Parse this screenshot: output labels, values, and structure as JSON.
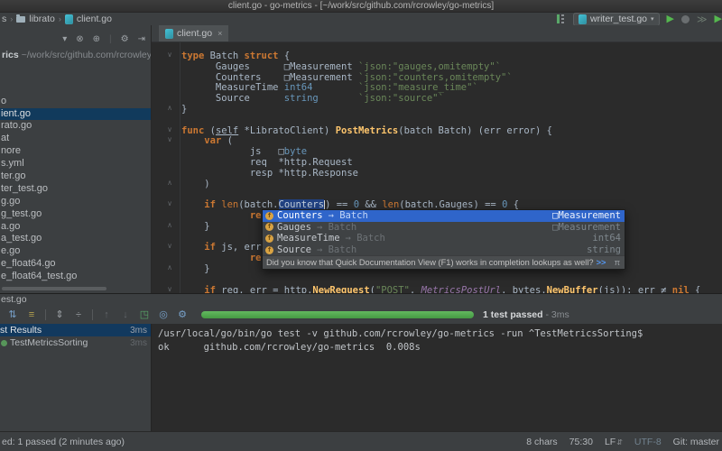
{
  "icons": {
    "chevron": "›",
    "dropdown": "▾",
    "gear": "⚙",
    "close": "×",
    "run": "▶",
    "coverage": "≫",
    "locate": "⊗",
    "target": "⊕",
    "hide_panel": "⇥",
    "lf_arrows": "⇵",
    "fold_open": "∨",
    "fold_close": "∧",
    "pi": "π",
    "link_arrows": ">>",
    "field": "f"
  },
  "titlebar": {
    "title": "client.go - go-metrics - [~/work/src/github.com/rcrowley/go-metrics]"
  },
  "navbar": {
    "crumbs": [
      {
        "label": "s"
      },
      {
        "label": "librato"
      },
      {
        "label": "client.go"
      }
    ],
    "run_config": "writer_test.go"
  },
  "project_panel": {
    "root_name": "rics",
    "root_path": " ~/work/src/github.com/rcrowley",
    "items": [
      {
        "label": ""
      },
      {
        "label": ""
      },
      {
        "label": ""
      },
      {
        "label": "o"
      },
      {
        "label": "ient.go",
        "selected": true
      },
      {
        "label": "rato.go"
      },
      {
        "label": "at"
      },
      {
        "label": "nore"
      },
      {
        "label": "s.yml"
      },
      {
        "label": "ter.go"
      },
      {
        "label": "ter_test.go"
      },
      {
        "label": "g.go"
      },
      {
        "label": "g_test.go"
      },
      {
        "label": "a.go"
      },
      {
        "label": "a_test.go"
      },
      {
        "label": "e.go"
      },
      {
        "label": "e_float64.go"
      },
      {
        "label": "e_float64_test.go"
      }
    ]
  },
  "editor": {
    "tab": "client.go",
    "lines": [
      [
        {
          "t": "type ",
          "c": "k"
        },
        {
          "t": "Batch ",
          "c": "p"
        },
        {
          "t": "struct ",
          "c": "k"
        },
        {
          "t": "{",
          "c": "p"
        }
      ],
      [
        {
          "t": "      Gauges      ",
          "c": "p"
        },
        {
          "t": "□Measurement ",
          "c": "p"
        },
        {
          "t": "`json:\"gauges,omitempty\"`",
          "c": "s"
        }
      ],
      [
        {
          "t": "      Counters    ",
          "c": "p"
        },
        {
          "t": "□Measurement ",
          "c": "p"
        },
        {
          "t": "`json:\"counters,omitempty\"`",
          "c": "s"
        }
      ],
      [
        {
          "t": "      MeasureTime ",
          "c": "p"
        },
        {
          "t": "int64",
          "c": "t"
        },
        {
          "t": "        ",
          "c": "p"
        },
        {
          "t": "`json:\"measure_time\"`",
          "c": "s"
        }
      ],
      [
        {
          "t": "      Source      ",
          "c": "p"
        },
        {
          "t": "string",
          "c": "t"
        },
        {
          "t": "       ",
          "c": "p"
        },
        {
          "t": "`json:\"source\"`",
          "c": "s"
        }
      ],
      [
        {
          "t": "}",
          "c": "p"
        }
      ],
      [],
      [
        {
          "t": "func ",
          "c": "k"
        },
        {
          "t": "(",
          "c": "p"
        },
        {
          "t": "self",
          "c": "u"
        },
        {
          "t": " *LibratoClient) ",
          "c": "p"
        },
        {
          "t": "PostMetrics",
          "c": "f"
        },
        {
          "t": "(batch Batch) (err error) {",
          "c": "p"
        }
      ],
      [
        {
          "t": "    ",
          "c": "p"
        },
        {
          "t": "var",
          "c": "k"
        },
        {
          "t": " (",
          "c": "p"
        }
      ],
      [
        {
          "t": "            js   ",
          "c": "p"
        },
        {
          "t": "□",
          "c": "p"
        },
        {
          "t": "byte",
          "c": "t"
        }
      ],
      [
        {
          "t": "            req  *http.Request",
          "c": "p"
        }
      ],
      [
        {
          "t": "            resp *http.Response",
          "c": "p"
        }
      ],
      [
        {
          "t": "    )",
          "c": "p"
        }
      ],
      [],
      [
        {
          "t": "    ",
          "c": "p"
        },
        {
          "t": "if ",
          "c": "k"
        },
        {
          "t": "len",
          "c": "b"
        },
        {
          "t": "(batch.",
          "c": "p"
        },
        {
          "t": "Counters",
          "c": "sel"
        },
        {
          "t": "",
          "c": "caret"
        },
        {
          "t": ") == ",
          "c": "p"
        },
        {
          "t": "0",
          "c": "n"
        },
        {
          "t": " && ",
          "c": "p"
        },
        {
          "t": "len",
          "c": "b"
        },
        {
          "t": "(batch.Gauges) == ",
          "c": "p"
        },
        {
          "t": "0",
          "c": "n"
        },
        {
          "t": " {",
          "c": "p"
        }
      ],
      [
        {
          "t": "            ",
          "c": "p"
        },
        {
          "t": "re",
          "c": "k"
        }
      ],
      [
        {
          "t": "    }",
          "c": "p"
        }
      ],
      [],
      [
        {
          "t": "    ",
          "c": "p"
        },
        {
          "t": "if ",
          "c": "k"
        },
        {
          "t": "js, err",
          "c": "p"
        }
      ],
      [
        {
          "t": "            ",
          "c": "p"
        },
        {
          "t": "re",
          "c": "k"
        }
      ],
      [
        {
          "t": "    }",
          "c": "p"
        }
      ],
      [],
      [
        {
          "t": "    ",
          "c": "p"
        },
        {
          "t": "if ",
          "c": "k"
        },
        {
          "t": "req, err = http.",
          "c": "p"
        },
        {
          "t": "NewRequest",
          "c": "f"
        },
        {
          "t": "(",
          "c": "p"
        },
        {
          "t": "\"POST\"",
          "c": "s"
        },
        {
          "t": ", ",
          "c": "p"
        },
        {
          "t": "MetricsPostUrl",
          "c": "v"
        },
        {
          "t": ", bytes.",
          "c": "p"
        },
        {
          "t": "NewBuffer",
          "c": "f"
        },
        {
          "t": "(js)); err ≠ ",
          "c": "p"
        },
        {
          "t": "nil",
          "c": "k"
        },
        {
          "t": " {",
          "c": "p"
        }
      ]
    ],
    "folds": [
      {
        "i": 0,
        "t": "o"
      },
      {
        "i": 5,
        "t": "c"
      },
      {
        "i": 7,
        "t": "o"
      },
      {
        "i": 8,
        "t": "o"
      },
      {
        "i": 12,
        "t": "c"
      },
      {
        "i": 14,
        "t": "o"
      },
      {
        "i": 16,
        "t": "c"
      },
      {
        "i": 18,
        "t": "o"
      },
      {
        "i": 20,
        "t": "c"
      },
      {
        "i": 22,
        "t": "o"
      }
    ]
  },
  "completion": {
    "items": [
      {
        "label": "Counters",
        "origin": "→ Batch",
        "type": "□Measurement",
        "selected": true
      },
      {
        "label": "Gauges",
        "origin": "→ Batch",
        "type": "□Measurement"
      },
      {
        "label": "MeasureTime",
        "origin": "→ Batch",
        "type": "int64"
      },
      {
        "label": "Source",
        "origin": "→ Batch",
        "type": "string"
      }
    ],
    "hint": "Did you know that Quick Documentation View (F1) works in completion lookups as well?"
  },
  "test_panel": {
    "tab": "est.go",
    "toolbar": [
      {
        "g": "⇅",
        "c": "blue",
        "n": "sort-tests-icon"
      },
      {
        "g": "≡",
        "c": "yellow",
        "n": "filter-passed-icon"
      },
      {
        "g": "",
        "c": "sep",
        "n": "toolbar-separator"
      },
      {
        "g": "⇕",
        "c": "gray",
        "n": "expand-all-icon"
      },
      {
        "g": "÷",
        "c": "gray",
        "n": "collapse-all-icon"
      },
      {
        "g": "",
        "c": "sep",
        "n": "toolbar-separator"
      },
      {
        "g": "↑",
        "c": "dim",
        "n": "previous-failed-test-icon"
      },
      {
        "g": "↓",
        "c": "dim",
        "n": "next-failed-test-icon"
      },
      {
        "g": "◳",
        "c": "green",
        "n": "import-test-results-icon"
      },
      {
        "g": "◎",
        "c": "blue",
        "n": "track-running-test-icon"
      },
      {
        "g": "⚙",
        "c": "blue",
        "n": "test-settings-gear-icon"
      }
    ],
    "result": "1 test passed",
    "duration": "- 3ms",
    "rows": [
      {
        "label": "st Results",
        "time": "3ms",
        "selected": true
      },
      {
        "label": "TestMetricsSorting",
        "time": "3ms",
        "icon": true
      }
    ],
    "console": [
      "/usr/local/go/bin/go test -v github.com/rcrowley/go-metrics -run ^TestMetricsSorting$",
      "ok      github.com/rcrowley/go-metrics  0.008s"
    ]
  },
  "statusbar": {
    "left": "ed: 1 passed (2 minutes ago)",
    "chars": "8 chars",
    "position": "75:30",
    "line_sep": "LF",
    "encoding": "UTF-8",
    "vcs": "Git: master"
  }
}
